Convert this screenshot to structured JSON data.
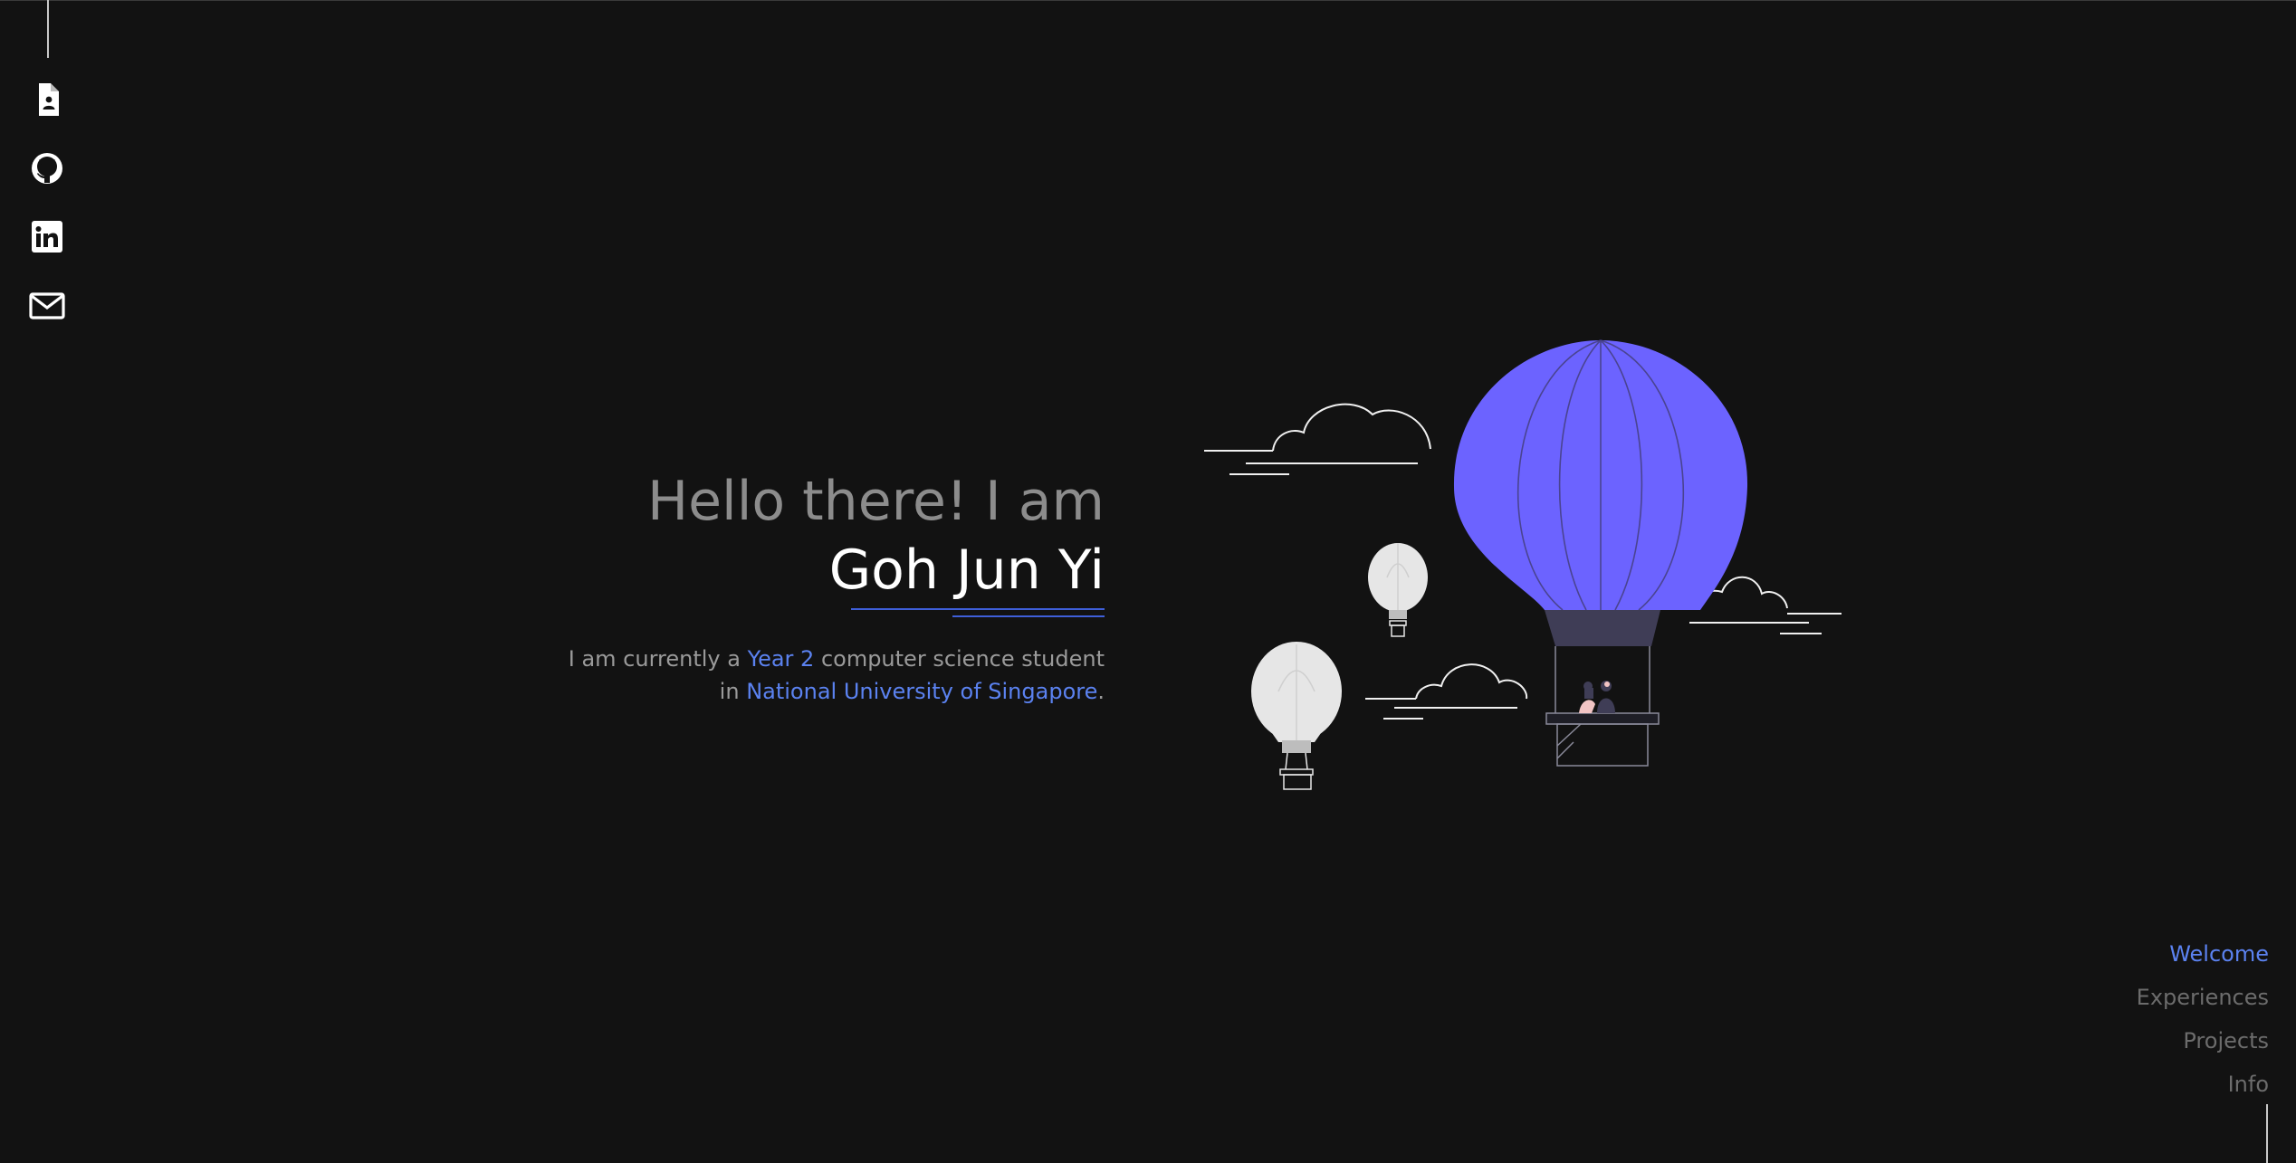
{
  "colors": {
    "background": "#121212",
    "accent": "#5b82f0",
    "balloon": "#6c63ff",
    "muted_text": "#8c8c8c"
  },
  "social": [
    {
      "name": "resume",
      "icon": "resume-document-icon"
    },
    {
      "name": "github",
      "icon": "github-icon"
    },
    {
      "name": "linkedin",
      "icon": "linkedin-icon"
    },
    {
      "name": "email",
      "icon": "mail-icon"
    }
  ],
  "hero": {
    "greeting": "Hello there! I am",
    "name": "Goh Jun Yi",
    "intro_prefix": "I am currently a ",
    "year": "Year 2",
    "intro_middle": " computer science student",
    "intro_in": "in ",
    "university": "National University of Singapore",
    "intro_suffix": "."
  },
  "nav": {
    "items": [
      "Welcome",
      "Experiences",
      "Projects",
      "Info"
    ],
    "active": "Welcome"
  }
}
